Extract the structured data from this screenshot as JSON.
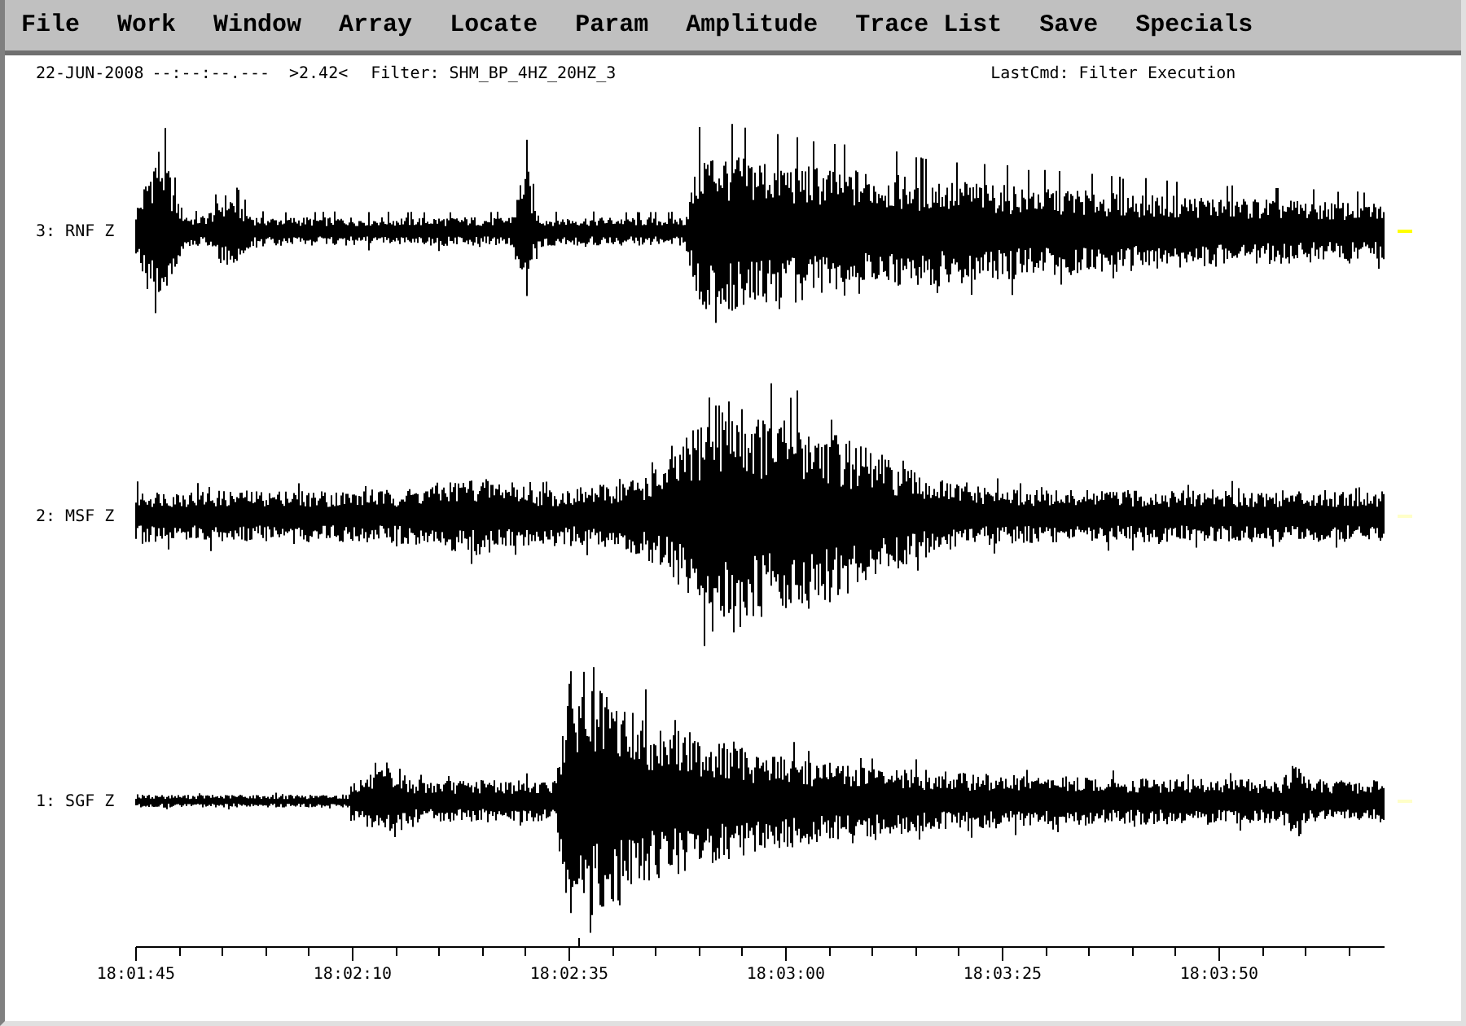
{
  "menu": [
    "File",
    "Work",
    "Window",
    "Array",
    "Locate",
    "Param",
    "Amplitude",
    "Trace List",
    "Save",
    "Specials"
  ],
  "header": {
    "date": "22-JUN-2008",
    "time": "--:--:--.---",
    "scale": ">2.42<",
    "filter": "Filter: SHM_BP_4HZ_20HZ_3",
    "last_cmd": "LastCmd: Filter Execution"
  },
  "traces": [
    {
      "label": "3: RNF Z",
      "color": "#ffff00"
    },
    {
      "label": "2: MSF Z",
      "color": "#ffffc8"
    },
    {
      "label": "1: SGF Z",
      "color": "#ffffc8"
    }
  ],
  "time_axis": {
    "labels": [
      "18:01:45",
      "18:02:10",
      "18:02:35",
      "18:03:00",
      "18:03:25",
      "18:03:50"
    ]
  }
}
